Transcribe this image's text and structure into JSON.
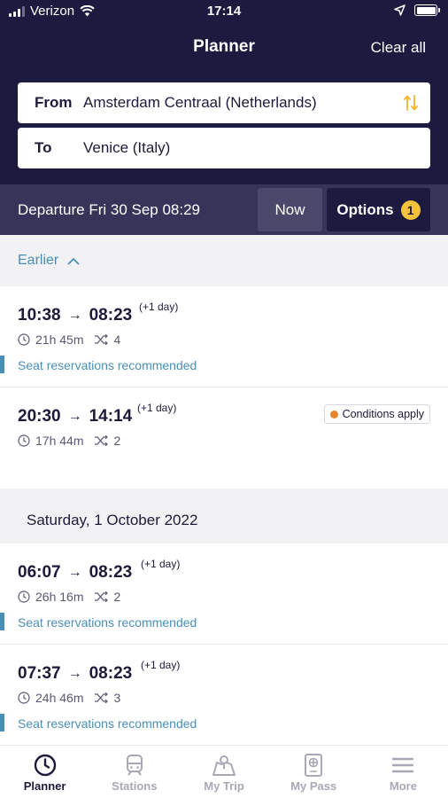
{
  "status": {
    "carrier": "Verizon",
    "time": "17:14"
  },
  "header": {
    "title": "Planner",
    "clear_label": "Clear all"
  },
  "search": {
    "from_label": "From",
    "from_value": "Amsterdam Centraal (Netherlands)",
    "to_label": "To",
    "to_value": "Venice (Italy)"
  },
  "departure": {
    "text": "Departure Fri 30 Sep 08:29",
    "now_label": "Now",
    "options_label": "Options",
    "options_count": "1"
  },
  "earlier_label": "Earlier",
  "trips_day1": [
    {
      "dep": "10:38",
      "arr": "08:23",
      "plus": "(+1 day)",
      "duration": "21h 45m",
      "transfers": "4",
      "note": "Seat reservations recommended"
    },
    {
      "dep": "20:30",
      "arr": "14:14",
      "plus": "(+1 day)",
      "duration": "17h 44m",
      "transfers": "2",
      "badge": "Conditions apply"
    }
  ],
  "day2_header": "Saturday, 1 October 2022",
  "trips_day2": [
    {
      "dep": "06:07",
      "arr": "08:23",
      "plus": "(+1 day)",
      "duration": "26h 16m",
      "transfers": "2",
      "note": "Seat reservations recommended"
    },
    {
      "dep": "07:37",
      "arr": "08:23",
      "plus": "(+1 day)",
      "duration": "24h 46m",
      "transfers": "3",
      "note": "Seat reservations recommended"
    }
  ],
  "tabs": [
    {
      "label": "Planner",
      "icon": "clock-icon",
      "active": true
    },
    {
      "label": "Stations",
      "icon": "train-icon"
    },
    {
      "label": "My Trip",
      "icon": "map-icon"
    },
    {
      "label": "My Pass",
      "icon": "passport-icon"
    },
    {
      "label": "More",
      "icon": "menu-icon"
    }
  ],
  "colors": {
    "header_bg": "#1d1a3f",
    "depbar_bg": "#37345a",
    "accent_blue": "#4a8fb7",
    "badge_yellow": "#f5c23a",
    "condition_orange": "#e8852e"
  }
}
